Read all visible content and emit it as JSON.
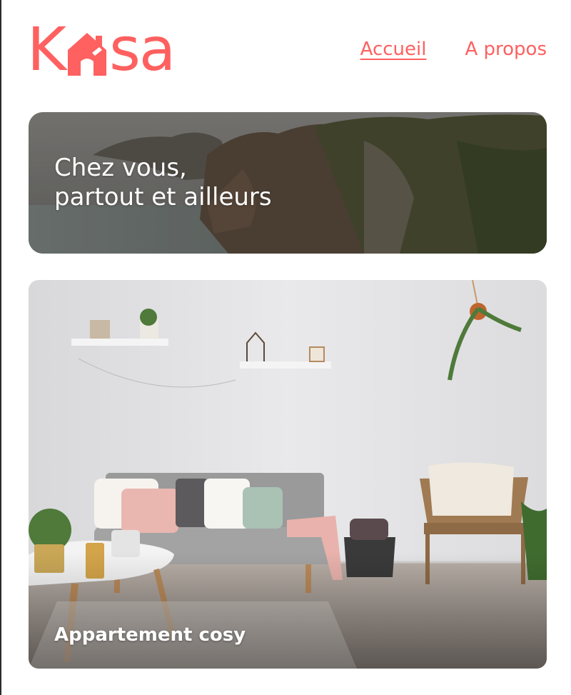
{
  "app": {
    "logo": {
      "letter_k": "K",
      "letters_rest": "sa"
    }
  },
  "nav": {
    "home": "Accueil",
    "about": "A propos"
  },
  "banner": {
    "line1": "Chez vous,",
    "line2": "partout et ailleurs"
  },
  "listings": [
    {
      "title": "Appartement cosy"
    }
  ],
  "colors": {
    "brand": "#ff6060",
    "background": "#ffffff"
  }
}
